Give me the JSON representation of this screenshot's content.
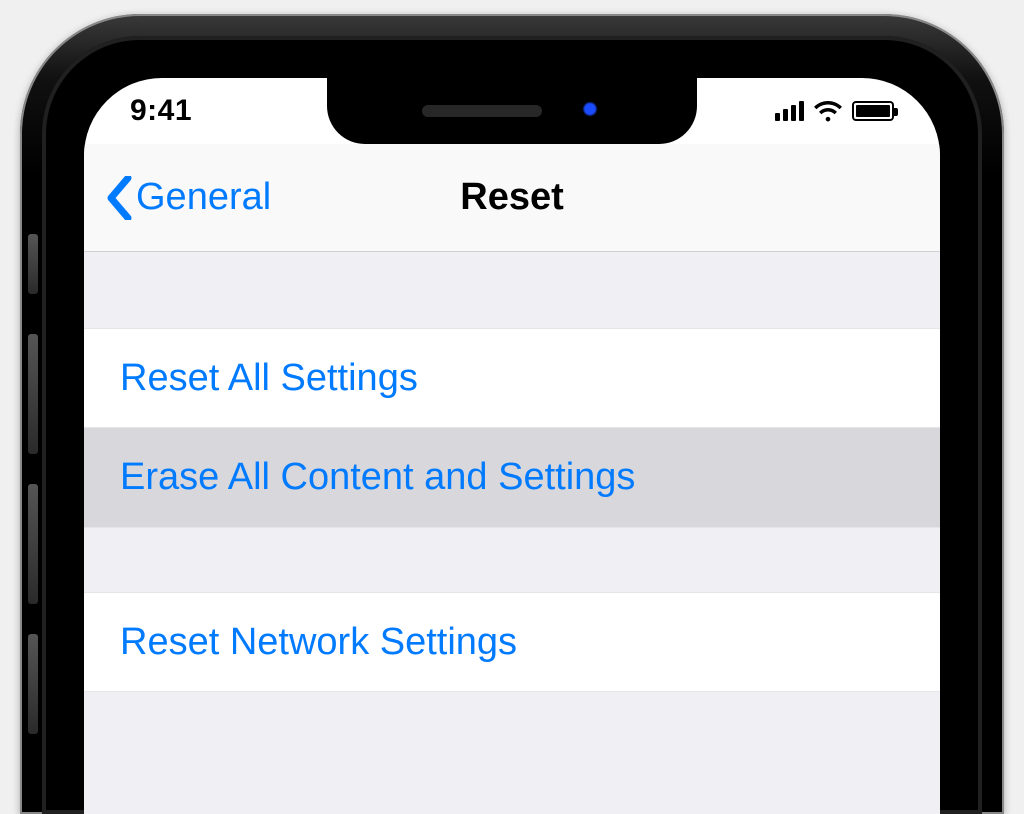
{
  "status": {
    "time": "9:41"
  },
  "nav": {
    "back_label": "General",
    "title": "Reset"
  },
  "cells": {
    "reset_all": "Reset All Settings",
    "erase_all": "Erase All Content and Settings",
    "reset_network": "Reset Network Settings"
  },
  "colors": {
    "tint": "#007aff"
  }
}
